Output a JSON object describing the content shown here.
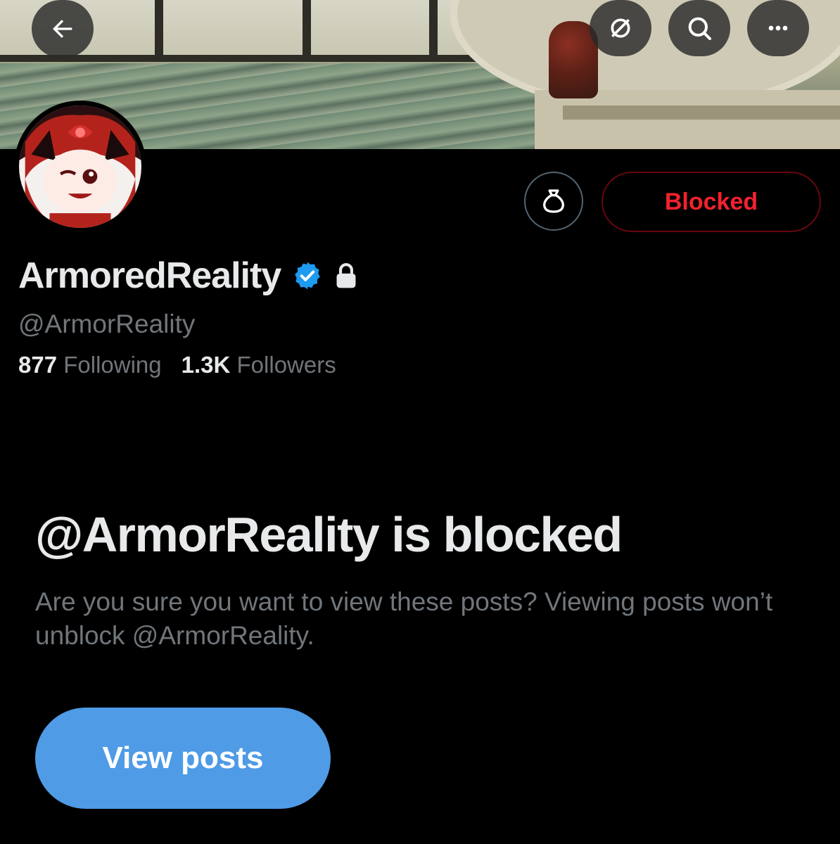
{
  "header": {
    "back_icon": "arrow-left-icon",
    "grok_icon": "grok-icon",
    "search_icon": "search-icon",
    "more_icon": "more-icon"
  },
  "profile": {
    "display_name": "ArmoredReality",
    "handle": "@ArmorReality",
    "following_count": "877",
    "following_label": "Following",
    "followers_count": "1.3K",
    "followers_label": "Followers",
    "verified_icon": "verified-badge-icon",
    "protected_icon": "lock-icon"
  },
  "actions": {
    "bag_icon": "money-bag-icon",
    "blocked_label": "Blocked"
  },
  "blocked_notice": {
    "title": "@ArmorReality is blocked",
    "description": "Are you sure you want to view these posts? Viewing posts won’t unblock @ArmorReality.",
    "view_button_label": "View posts"
  },
  "colors": {
    "background": "#000000",
    "text_primary": "#e7e9ea",
    "text_secondary": "#71767b",
    "blocked_red": "#f4212e",
    "verified_blue": "#1d9bf0",
    "button_blue": "#4f9be6"
  }
}
